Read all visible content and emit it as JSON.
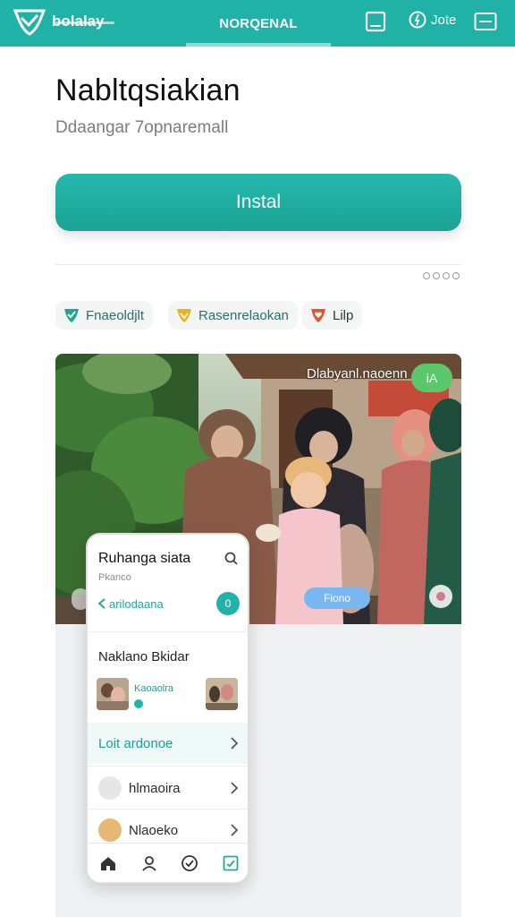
{
  "topbar": {
    "brand": "bolalay",
    "tab": "NORQENAL",
    "login": "Jote",
    "icons": [
      "logo-shield-icon",
      "tablet-icon",
      "info-circle-icon",
      "card-icon"
    ]
  },
  "hero": {
    "title": "Nabltqsiakian",
    "subtitle": "Ddaangar 7opnaremall",
    "install_label": "Instal"
  },
  "chips": [
    {
      "label": "Fnaeoldjlt",
      "icon": "shield-check-icon",
      "color": "#1aa88e"
    },
    {
      "label": "Rasenrelaokan",
      "icon": "shield-star-icon",
      "color": "#e9b21f"
    },
    {
      "label": "Lilp",
      "icon": "heart-shield-icon",
      "color": "#e2552e"
    }
  ],
  "photo": {
    "overlay_text": "Dlabyanl.naoenn",
    "overlay_button": "iA",
    "pill_label": "Fiono"
  },
  "phone": {
    "title": "Ruhanga siata",
    "subtitle": "Pkanco",
    "link": "arilodaana",
    "link_button": "0",
    "section": "Naklano Bkidar",
    "thumb_label": "Kaoaolra",
    "rows": [
      {
        "label": "Loit ardonoe"
      },
      {
        "label": "hlmaoira"
      },
      {
        "label": "Nlaoeko"
      }
    ],
    "nav": [
      "home-icon",
      "person-icon",
      "check-circle-icon",
      "edit-square-icon"
    ]
  },
  "colors": {
    "accent": "#20b2a6",
    "accent_dark": "#1ca396",
    "pill": "#78b7f0",
    "overlay_button": "#5ac86a"
  }
}
